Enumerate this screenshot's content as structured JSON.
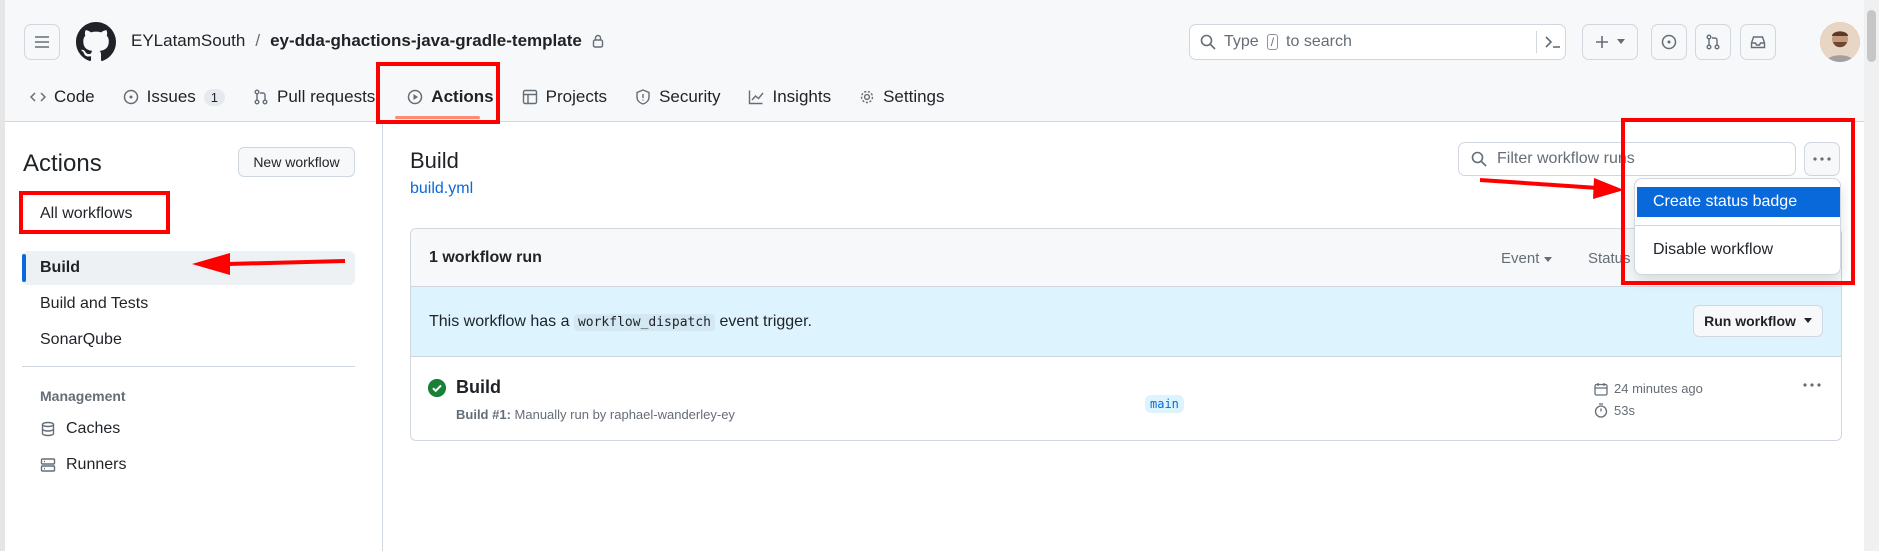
{
  "header": {
    "owner": "EYLatamSouth",
    "separator": "/",
    "repo": "ey-dda-ghactions-java-gradle-template",
    "search_prefix": "Type",
    "search_key": "/",
    "search_suffix": "to search"
  },
  "tabs": [
    {
      "label": "Code",
      "icon": "code-icon"
    },
    {
      "label": "Issues",
      "icon": "issue-icon",
      "count": "1"
    },
    {
      "label": "Pull requests",
      "icon": "pull-request-icon"
    },
    {
      "label": "Actions",
      "icon": "play-icon"
    },
    {
      "label": "Projects",
      "icon": "table-icon"
    },
    {
      "label": "Security",
      "icon": "shield-icon"
    },
    {
      "label": "Insights",
      "icon": "graph-icon"
    },
    {
      "label": "Settings",
      "icon": "gear-icon"
    }
  ],
  "sidebar": {
    "title": "Actions",
    "new_workflow": "New workflow",
    "all_workflows": "All workflows",
    "workflows": [
      "Build",
      "Build and Tests",
      "SonarQube"
    ],
    "management_heading": "Management",
    "management_items": [
      "Caches",
      "Runners"
    ]
  },
  "main": {
    "title": "Build",
    "file_link": "build.yml",
    "filter_placeholder": "Filter workflow runs",
    "run_count": "1 workflow run",
    "event_label": "Event",
    "status_label": "Status",
    "banner_prefix": "This workflow has a",
    "banner_code": "workflow_dispatch",
    "banner_suffix": "event trigger.",
    "run_workflow": "Run workflow",
    "run": {
      "name": "Build",
      "number": "Build #1:",
      "desc": "Manually run by raphael-wanderley-ey",
      "branch": "main",
      "time": "24 minutes ago",
      "duration": "53s"
    }
  },
  "dropdown": {
    "items": [
      "Create status badge",
      "Disable workflow"
    ]
  },
  "colors": {
    "accent": "#0969da",
    "success": "#1a7f37",
    "annotation": "#ff0000"
  }
}
